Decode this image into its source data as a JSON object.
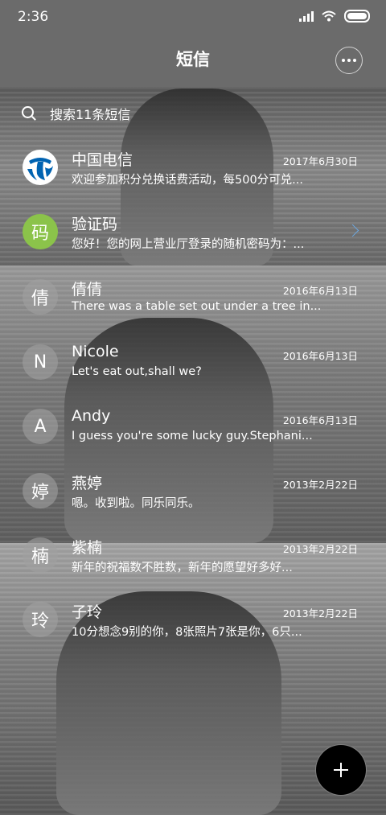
{
  "status": {
    "time": "2:36"
  },
  "header": {
    "title": "短信"
  },
  "search": {
    "placeholder": "搜索11条短信"
  },
  "messages": [
    {
      "name": "中国电信",
      "date": "2017年6月30日",
      "preview": "欢迎参加积分兑换话费活动，每500分可兑...",
      "avatar": "telecom-logo"
    },
    {
      "name": "验证码",
      "date": "",
      "preview": "您好！您的网上营业厅登录的随机密码为：...",
      "avatar": "码"
    },
    {
      "name": "倩倩",
      "date": "2016年6月13日",
      "preview": "There was a table set out under a tree in...",
      "avatar": "倩"
    },
    {
      "name": "Nicole",
      "date": "2016年6月13日",
      "preview": "Let's eat out,shall we?",
      "avatar": "N"
    },
    {
      "name": "Andy",
      "date": "2016年6月13日",
      "preview": "I guess you're some lucky guy.Stephani...",
      "avatar": "A"
    },
    {
      "name": "燕婷",
      "date": "2013年2月22日",
      "preview": "嗯。收到啦。同乐同乐。",
      "avatar": "婷"
    },
    {
      "name": "紫楠",
      "date": "2013年2月22日",
      "preview": "新年的祝福数不胜数，新年的愿望好多好...",
      "avatar": "楠"
    },
    {
      "name": "子玲",
      "date": "2013年2月22日",
      "preview": "10分想念9别的你，8张照片7张是你，6只...",
      "avatar": "玲"
    }
  ],
  "colors": {
    "verification_avatar": "#8bc34a",
    "fab": "#000000",
    "chevron": "#6ba7e0"
  }
}
